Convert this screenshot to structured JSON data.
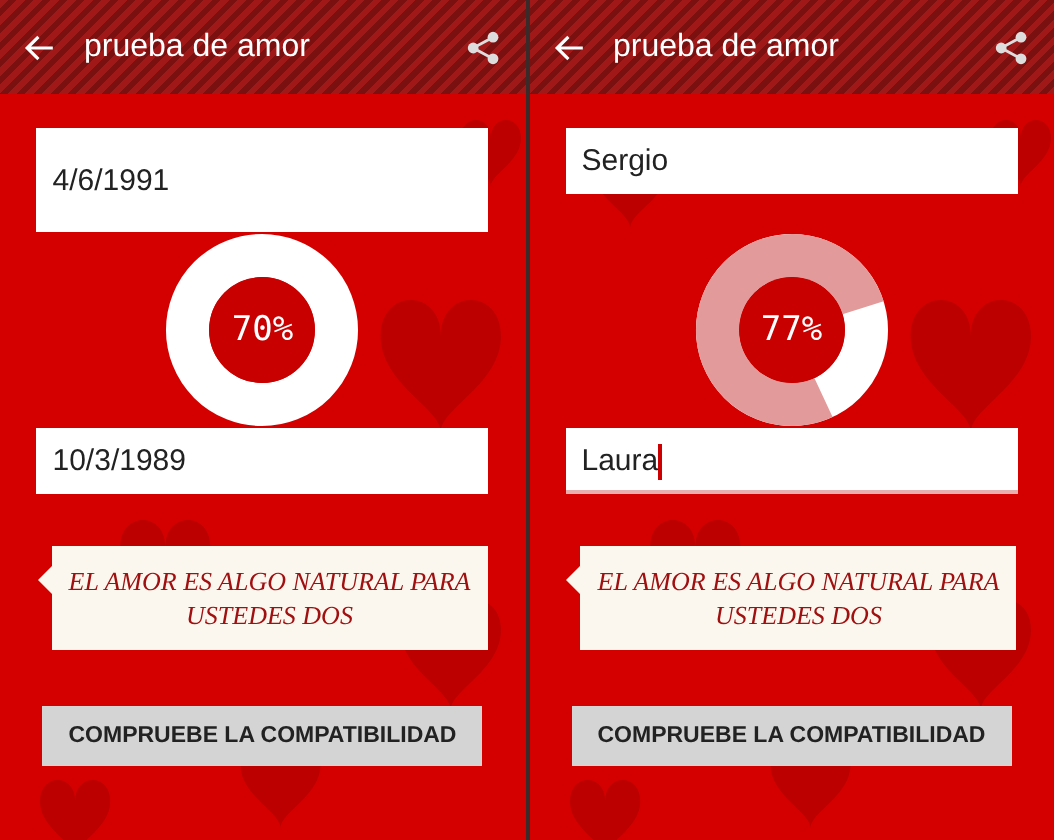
{
  "panels": [
    {
      "title": "prueba de amor",
      "fields": [
        {
          "value": "4/6/1991",
          "focused": false
        },
        {
          "value": "10/3/1989",
          "focused": false
        }
      ],
      "result": "70%",
      "level": 0,
      "message": "EL AMOR ES ALGO NATURAL PARA USTEDES DOS",
      "button": "COMPRUEBE LA COMPATIBILIDAD"
    },
    {
      "title": "prueba de amor",
      "fields": [
        {
          "value": "Sergio",
          "focused": false
        },
        {
          "value": "Laura",
          "focused": true
        }
      ],
      "result": "77%",
      "level": 0.77,
      "message": "EL AMOR ES ALGO NATURAL PARA USTEDES DOS",
      "button": "COMPRUEBE LA COMPATIBILIDAD"
    }
  ]
}
